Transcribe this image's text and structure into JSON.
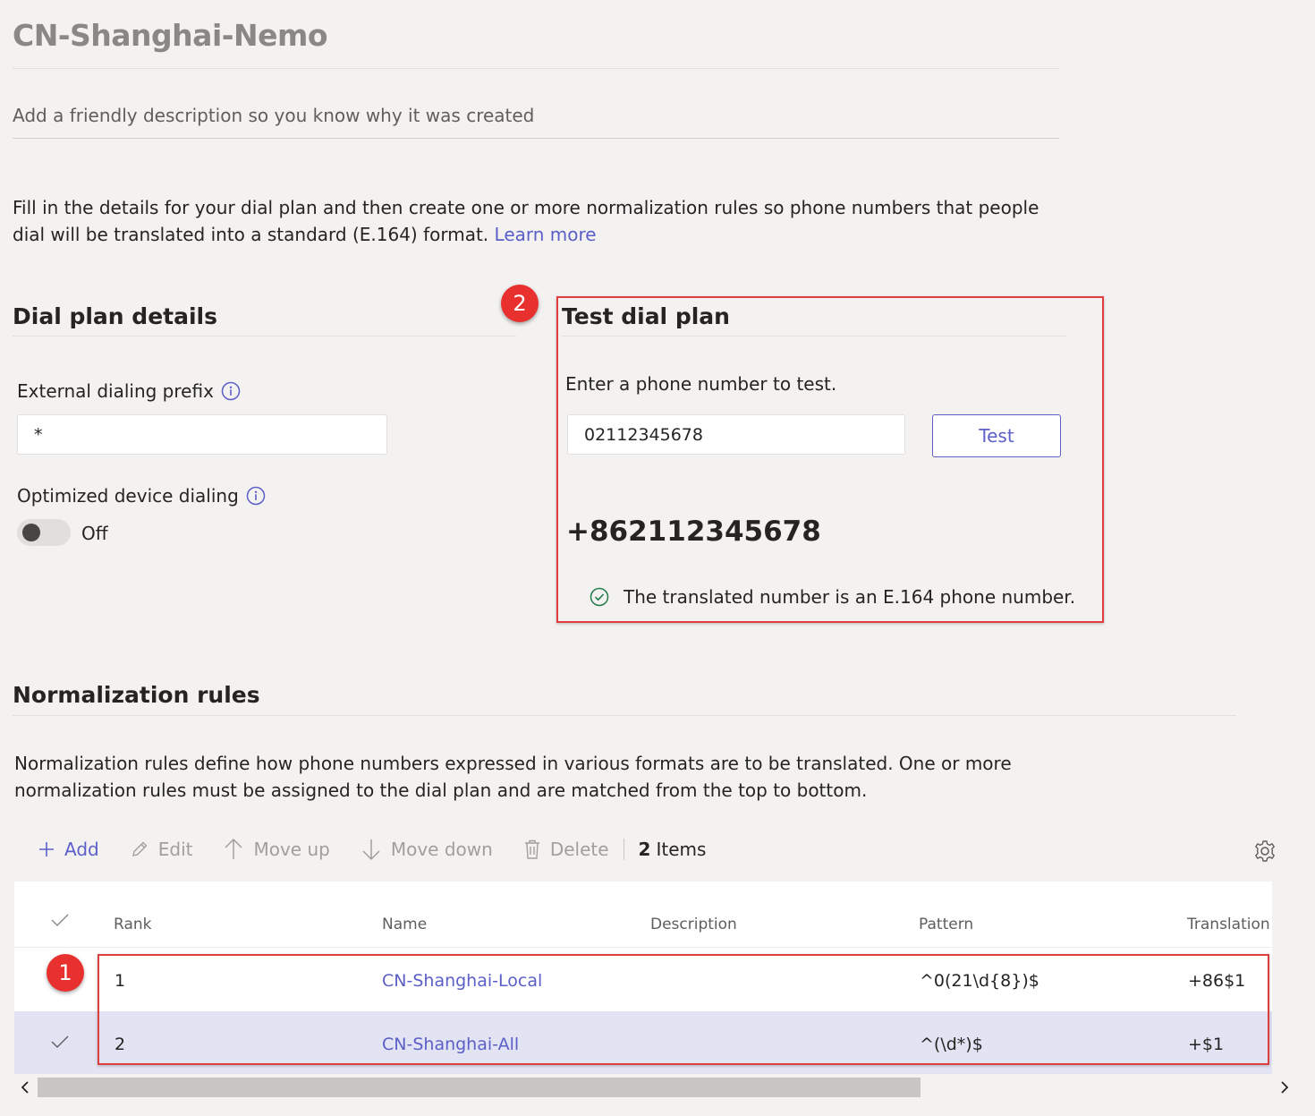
{
  "page": {
    "title": "CN-Shanghai-Nemo",
    "description_placeholder": "Add a friendly description so you know why it was created",
    "intro_text": "Fill in the details for your dial plan and then create one or more normalization rules so phone numbers that people dial will be translated into a standard (E.164) format.",
    "learn_more": "Learn more"
  },
  "dial_plan_details": {
    "heading": "Dial plan details",
    "external_prefix_label": "External dialing prefix",
    "external_prefix_value": "*",
    "optimized_label": "Optimized device dialing",
    "optimized_state": "Off"
  },
  "test_dial_plan": {
    "heading": "Test dial plan",
    "prompt": "Enter a phone number to test.",
    "input_value": "02112345678",
    "test_button": "Test",
    "result": "+862112345678",
    "result_message": "The translated number is an E.164 phone number."
  },
  "normalization": {
    "heading": "Normalization rules",
    "description": "Normalization rules define how phone numbers expressed in various formats are to be translated. One or more normalization rules must be assigned to the dial plan and are matched from the top to bottom.",
    "toolbar": {
      "add": "Add",
      "edit": "Edit",
      "move_up": "Move up",
      "move_down": "Move down",
      "delete": "Delete",
      "count": "2",
      "count_label": "Items"
    },
    "columns": [
      "Rank",
      "Name",
      "Description",
      "Pattern",
      "Translation"
    ],
    "rows": [
      {
        "rank": "1",
        "name": "CN-Shanghai-Local",
        "description": "",
        "pattern": "^0(21\\d{8})$",
        "translation": "+86$1"
      },
      {
        "rank": "2",
        "name": "CN-Shanghai-All",
        "description": "",
        "pattern": "^(\\d*)$",
        "translation": "+$1"
      }
    ]
  },
  "annotations": {
    "badge_1": "1",
    "badge_2": "2"
  },
  "colors": {
    "accent": "#5b5fc7",
    "annotation_red": "#e03e3e",
    "selected_row": "#e2e3f3",
    "success": "#237b4b"
  }
}
